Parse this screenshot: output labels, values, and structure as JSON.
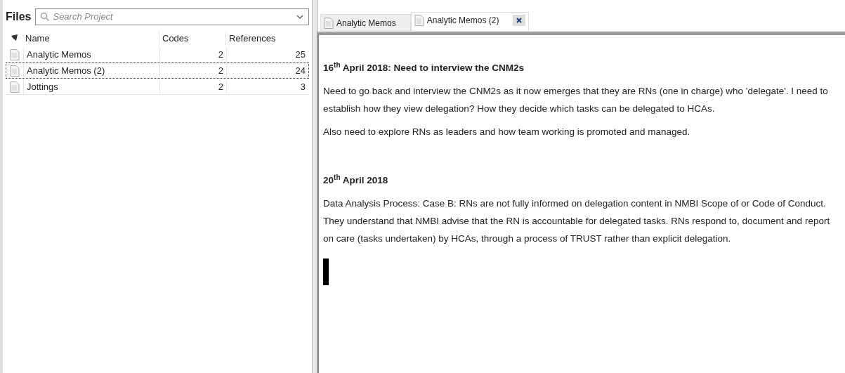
{
  "files_panel": {
    "title": "Files",
    "search": {
      "placeholder": "Search Project"
    },
    "columns": [
      "Name",
      "Codes",
      "References"
    ],
    "rows": [
      {
        "name": "Analytic Memos",
        "codes": "2",
        "references": "25",
        "selected": false
      },
      {
        "name": "Analytic Memos (2)",
        "codes": "2",
        "references": "24",
        "selected": true
      },
      {
        "name": "Jottings",
        "codes": "2",
        "references": "3",
        "selected": false
      }
    ]
  },
  "tabs": [
    {
      "label": "Analytic Memos",
      "selected": false
    },
    {
      "label": "Analytic Memos (2)",
      "selected": true,
      "closable": true
    }
  ],
  "document": {
    "blocks": [
      {
        "kind": "heading",
        "text": "16$^{th}$ April 2018: Need to interview the CNM2s"
      },
      {
        "kind": "paragraph",
        "text": "Need to go back and interview the CNM2s as it now emerges that they are RNs (one in charge) who 'delegate'. I need to establish how they view delegation? How they decide which tasks can be delegated to HCAs."
      },
      {
        "kind": "paragraph",
        "text": "Also need to explore RNs as leaders and how team working is promoted and managed."
      },
      {
        "kind": "spacer"
      },
      {
        "kind": "heading",
        "text": "20$^{th}$ April 2018"
      },
      {
        "kind": "paragraph",
        "text": "Data Analysis Process: Case B: RNs are not fully informed on delegation content in NMBI Scope of or Code of Conduct. They understand that NMBI advise that the RN is accountable for delegated tasks. RNs respond to, document and report on care (tasks undertaken) by HCAs, through a process of TRUST rather than explicit delegation."
      }
    ],
    "cursor": true
  }
}
